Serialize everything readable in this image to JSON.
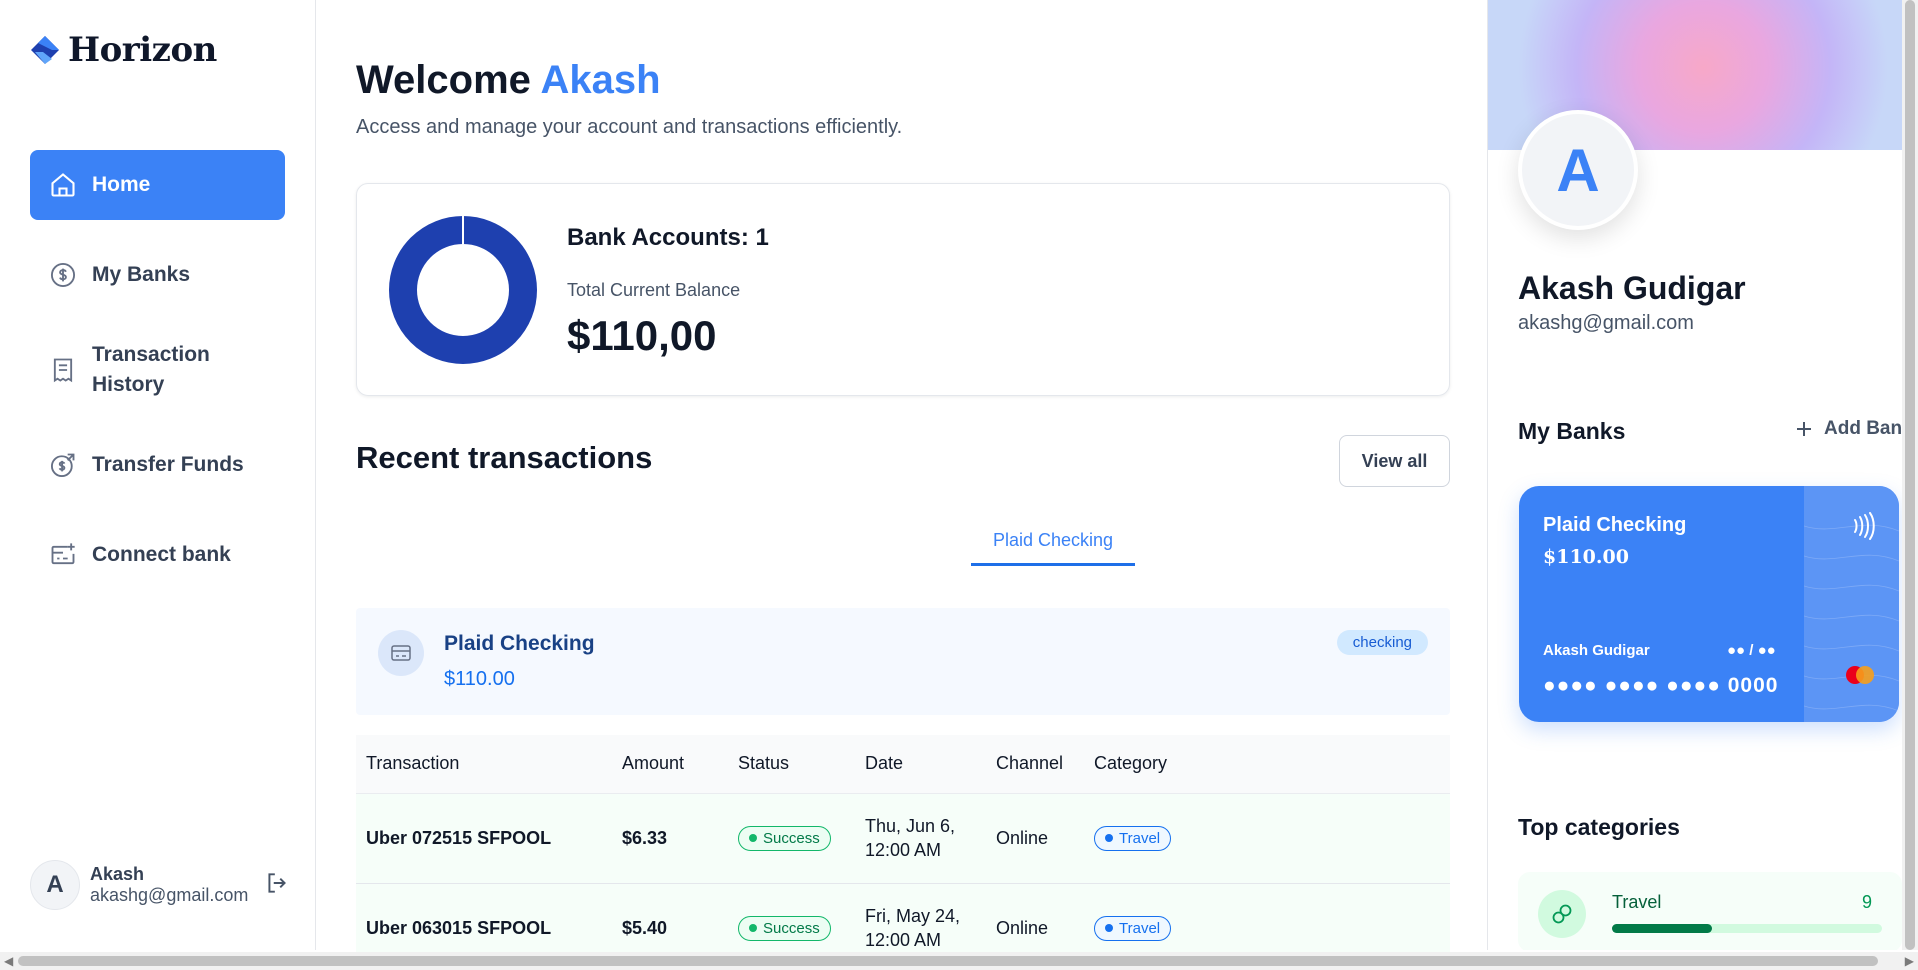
{
  "brand": {
    "name": "Horizon"
  },
  "sidebar": {
    "items": [
      {
        "label": "Home",
        "icon": "home-icon",
        "active": true
      },
      {
        "label": "My Banks",
        "icon": "dollar-circle-icon",
        "active": false
      },
      {
        "label": "Transaction History",
        "icon": "receipt-icon",
        "active": false
      },
      {
        "label": "Transfer Funds",
        "icon": "money-send-icon",
        "active": false
      },
      {
        "label": "Connect bank",
        "icon": "card-add-icon",
        "active": false
      }
    ],
    "footer": {
      "initial": "A",
      "name": "Akash",
      "email": "akashg@gmail.com"
    }
  },
  "header": {
    "greeting": "Welcome",
    "user": "Akash",
    "subtitle": "Access and manage your account and transactions efficiently."
  },
  "balance": {
    "accounts_label": "Bank Accounts: 1",
    "total_label": "Total Current Balance",
    "total_value": "$110,00"
  },
  "transactions": {
    "title": "Recent transactions",
    "view_all": "View all",
    "tab": "Plaid Checking",
    "account": {
      "name": "Plaid Checking",
      "balance": "$110.00",
      "type": "checking"
    },
    "columns": [
      "Transaction",
      "Amount",
      "Status",
      "Date",
      "Channel",
      "Category"
    ],
    "rows": [
      {
        "name": "Uber 072515 SFPOOL",
        "amount": "$6.33",
        "status": "Success",
        "date1": "Thu, Jun 6,",
        "date2": "12:00 AM",
        "channel": "Online",
        "category": "Travel"
      },
      {
        "name": "Uber 063015 SFPOOL",
        "amount": "$5.40",
        "status": "Success",
        "date1": "Fri, May 24,",
        "date2": "12:00 AM",
        "channel": "Online",
        "category": "Travel"
      }
    ]
  },
  "profile": {
    "initial": "A",
    "name": "Akash Gudigar",
    "email": "akashg@gmail.com"
  },
  "my_banks": {
    "title": "My Banks",
    "add_label": "Add Bank",
    "card": {
      "name": "Plaid Checking",
      "balance": "$110.00",
      "holder": "Akash Gudigar",
      "expiry": "●● / ●●",
      "number": "●●●● ●●●● ●●●● 0000"
    }
  },
  "top_categories": {
    "title": "Top categories",
    "items": [
      {
        "name": "Travel",
        "count": "9",
        "progress": 0.37
      }
    ]
  },
  "colors": {
    "accent": "#3b82f6",
    "success": "#039855",
    "category": "#1570ef"
  }
}
